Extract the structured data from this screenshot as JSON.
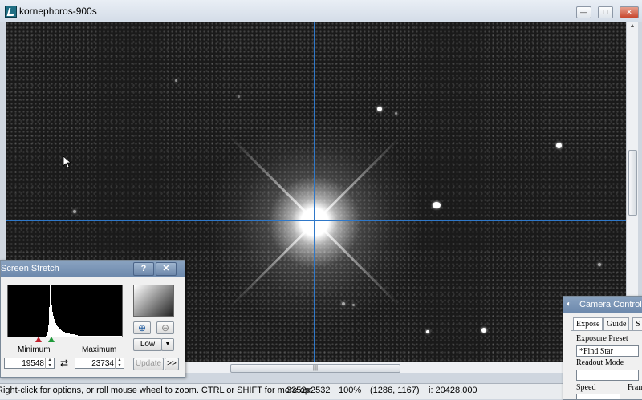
{
  "window": {
    "title": "kornephoros-900s",
    "minimize_label": "—",
    "maximize_label": "□",
    "close_label": "✕"
  },
  "scroll": {
    "h_grip": "|||"
  },
  "status": {
    "hint": "Right-click for options, or roll mouse wheel to zoom. CTRL or SHIFT for more opt",
    "dimensions": "3352x2532",
    "zoom": "100%",
    "coords": "(1286, 1167)",
    "intensity": "i: 20428.000"
  },
  "stretch_panel": {
    "title": "Screen Stretch",
    "help_label": "?",
    "close_label": "✕",
    "minimum_label": "Minimum",
    "maximum_label": "Maximum",
    "minimum_value": "19548",
    "maximum_value": "23734",
    "swap_icon": "⇄",
    "zoom_in_icon": "⊕",
    "zoom_out_icon": "⊖",
    "preset": "Low",
    "update_label": "Update",
    "more_label": ">>"
  },
  "camera_panel": {
    "title": "Camera Control",
    "tabs": [
      "Expose",
      "Guide",
      "S"
    ],
    "exposure_preset_label": "Exposure Preset",
    "exposure_preset_value": "*Find Star",
    "readout_mode_label": "Readout Mode",
    "speed_label": "Speed",
    "frame_label": "Fram"
  },
  "colors": {
    "crosshair": "#2f78c9",
    "panel_title": "#7a95b7"
  },
  "histogram": [
    0,
    0,
    0,
    0,
    0,
    0,
    0,
    0,
    0,
    0,
    0,
    0,
    0,
    0,
    0,
    0,
    0,
    0,
    0,
    0,
    0,
    0,
    0,
    0,
    0,
    0,
    0,
    0,
    0,
    0,
    0,
    0,
    0,
    0,
    0,
    0,
    0,
    0,
    0,
    0,
    0,
    0,
    0,
    0,
    0,
    0,
    0,
    2,
    4,
    10,
    22,
    58,
    100,
    85,
    62,
    48,
    40,
    34,
    30,
    26,
    22,
    20,
    18,
    16,
    15,
    14,
    12,
    11,
    10,
    10,
    9,
    8,
    8,
    7,
    7,
    6,
    6,
    5,
    5,
    5,
    4,
    4,
    4,
    3,
    3,
    3,
    3,
    2,
    2,
    2,
    2,
    2,
    2,
    2,
    1,
    1,
    1,
    1,
    1,
    1,
    1,
    1,
    1,
    1,
    1,
    1,
    1,
    1,
    1,
    1,
    1,
    1,
    1,
    1,
    1,
    1,
    1,
    1,
    1,
    1,
    1,
    1,
    1,
    1,
    1,
    1,
    1,
    1,
    1,
    1,
    1,
    1,
    1,
    1,
    1,
    1,
    1,
    1,
    1,
    1,
    1,
    1,
    1
  ]
}
